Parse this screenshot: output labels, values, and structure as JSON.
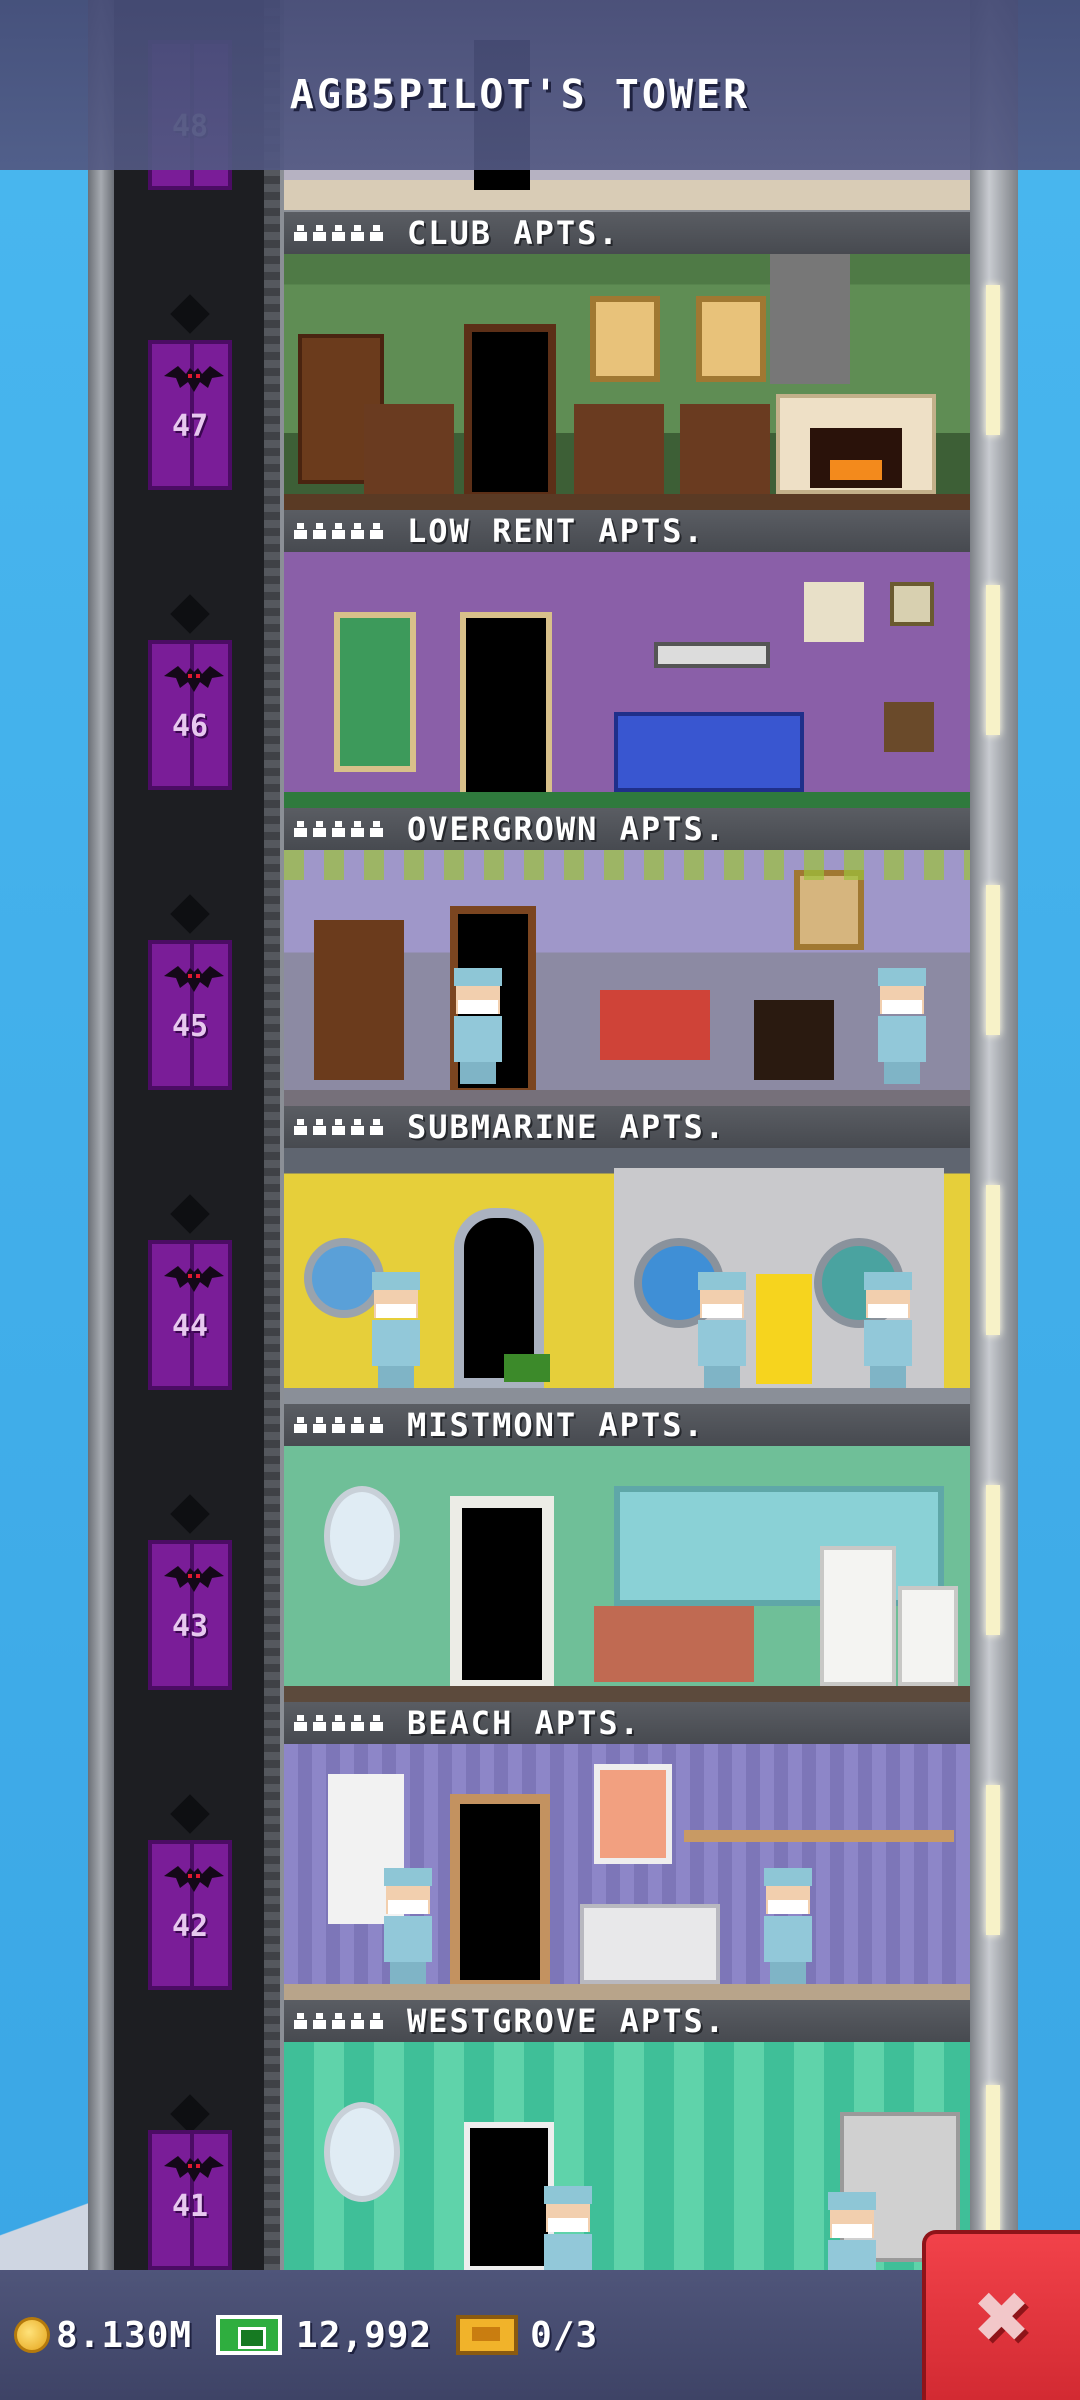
{
  "tower": {
    "title": "AGB5PILOT'S TOWER"
  },
  "floors": [
    {
      "number": "48",
      "name": ""
    },
    {
      "number": "47",
      "name": "CLUB APTS."
    },
    {
      "number": "46",
      "name": "LOW RENT APTS."
    },
    {
      "number": "45",
      "name": "OVERGROWN APTS."
    },
    {
      "number": "44",
      "name": "SUBMARINE APTS."
    },
    {
      "number": "43",
      "name": "MISTMONT APTS."
    },
    {
      "number": "42",
      "name": "BEACH APTS."
    },
    {
      "number": "41",
      "name": "WESTGROVE APTS."
    }
  ],
  "hud": {
    "coins": "8.130M",
    "bux": "12,992",
    "tickets": "0/3",
    "close_label": "✖"
  },
  "colors": {
    "sky": "#49b7ef",
    "elevator": "#7a1d98",
    "close_button": "#e0343c",
    "hud_bar": "#474c70"
  }
}
